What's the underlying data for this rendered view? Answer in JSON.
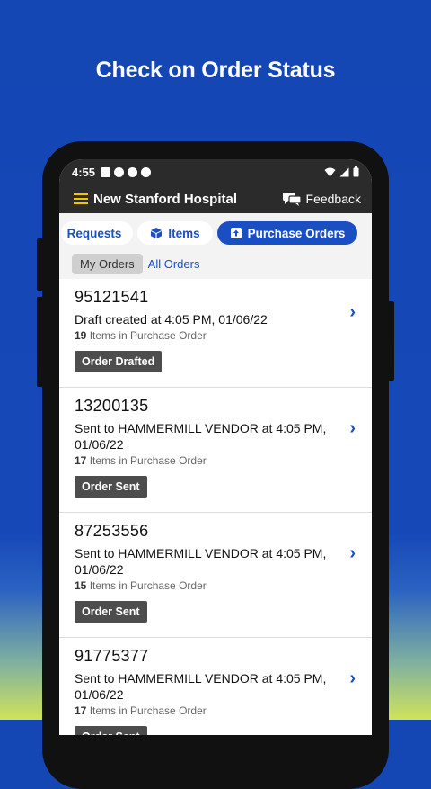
{
  "headline": "Check on Order Status",
  "status_bar": {
    "time": "4:55"
  },
  "app_bar": {
    "title": "New Stanford Hospital",
    "feedback_label": "Feedback"
  },
  "tabs": [
    {
      "label": "Requests",
      "active": false
    },
    {
      "label": "Items",
      "active": false
    },
    {
      "label": "Purchase Orders",
      "active": true
    }
  ],
  "subtabs": {
    "my_orders": "My Orders",
    "all_orders": "All Orders"
  },
  "orders": [
    {
      "id": "95121541",
      "desc": "Draft created at 4:05 PM, 01/06/22",
      "count": "19",
      "count_suffix": " Items in Purchase Order",
      "status": "Order Drafted"
    },
    {
      "id": "13200135",
      "desc": "Sent to HAMMERMILL VENDOR at 4:05 PM, 01/06/22",
      "count": "17",
      "count_suffix": " Items in Purchase Order",
      "status": "Order Sent"
    },
    {
      "id": "87253556",
      "desc": "Sent to HAMMERMILL VENDOR at 4:05 PM, 01/06/22",
      "count": "15",
      "count_suffix": " Items in Purchase Order",
      "status": "Order Sent"
    },
    {
      "id": "91775377",
      "desc": "Sent to HAMMERMILL VENDOR at 4:05 PM, 01/06/22",
      "count": "17",
      "count_suffix": " Items in Purchase Order",
      "status": "Order Sent"
    }
  ],
  "colors": {
    "accent": "#1a4fc4",
    "appbar": "#2b2b2b",
    "badge": "#4d4d4d",
    "background": "#1648b8"
  },
  "icons": [
    "hamburger-menu-icon",
    "feedback-chat-icon",
    "cube-icon",
    "upload-box-icon",
    "chevron-right-icon",
    "wifi-icon",
    "signal-icon",
    "battery-icon"
  ]
}
